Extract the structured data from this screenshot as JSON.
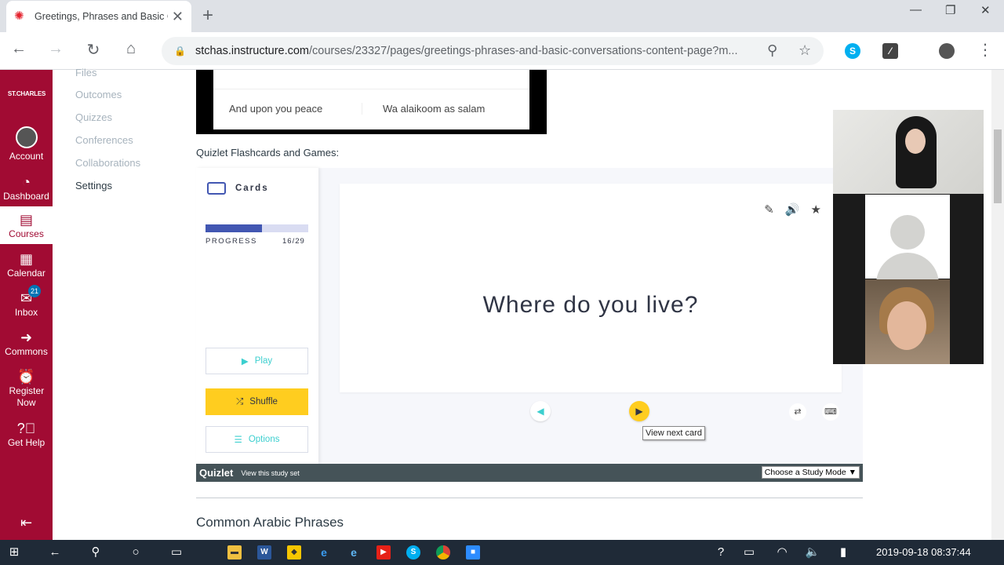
{
  "browser": {
    "tab_title": "Greetings, Phrases and Basic C",
    "url_host": "stchas.instructure.com",
    "url_path": "/courses/23327/pages/greetings-phrases-and-basic-conversations-content-page?m..."
  },
  "global_nav": {
    "logo": "ST.CHARLES",
    "items": [
      {
        "label": "Account"
      },
      {
        "label": "Dashboard"
      },
      {
        "label": "Courses"
      },
      {
        "label": "Calendar"
      },
      {
        "label": "Inbox",
        "badge": "21"
      },
      {
        "label": "Commons"
      },
      {
        "label": "Register Now"
      },
      {
        "label": "Get Help"
      }
    ]
  },
  "course_nav": {
    "items": [
      "Files",
      "Outcomes",
      "Quizzes",
      "Conferences",
      "Collaborations",
      "Settings"
    ]
  },
  "content": {
    "phrase_row": {
      "english": "And upon you peace",
      "arabic": "Wa alaikoom as salam"
    },
    "quizlet_label": "Quizlet Flashcards and Games:",
    "next_heading": "Common Arabic Phrases"
  },
  "quizlet": {
    "mode_label": "Cards",
    "progress_label": "PROGRESS",
    "progress_count": "16/29",
    "progress_fraction": 0.55,
    "play_label": "Play",
    "shuffle_label": "Shuffle",
    "options_label": "Options",
    "card_term": "Where do you live?",
    "tooltip": "View next card",
    "footer_brand": "Quizlet",
    "footer_link": "View this study set",
    "study_mode": "Choose a Study Mode ▼",
    "colors": {
      "primary": "#4257b2",
      "accent": "#ffcd1f",
      "teal": "#3ccfcf"
    }
  },
  "taskbar": {
    "clock": "2019-09-18 08:37:44"
  },
  "colors": {
    "canvas_nav": "#a10b33"
  }
}
